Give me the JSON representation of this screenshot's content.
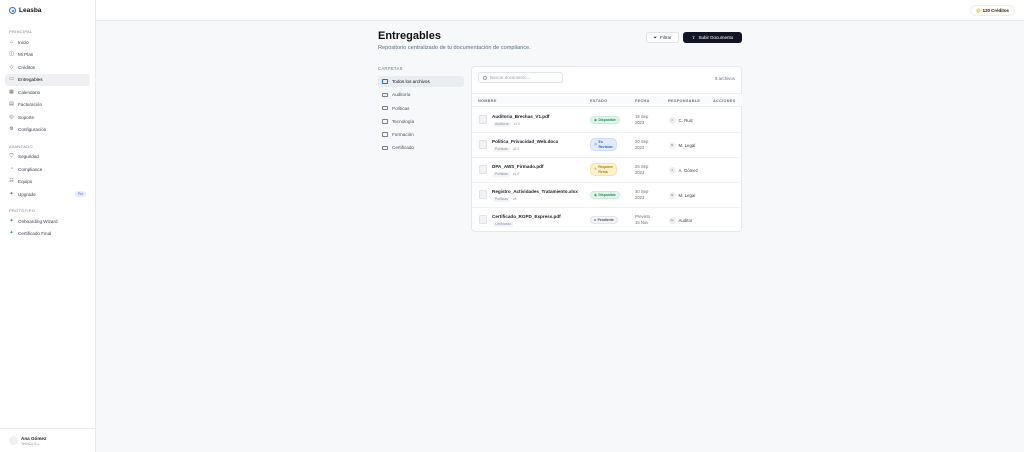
{
  "brand": {
    "name": "Leasba",
    "icon": "logo-icon"
  },
  "topbar": {
    "credits": "120 Créditos",
    "icon": "coin-icon"
  },
  "sidebar": {
    "sections": [
      {
        "label": "PRINCIPAL",
        "items": [
          {
            "label": "Inicio",
            "icon": "home-icon"
          },
          {
            "label": "Mi Plan",
            "icon": "plan-icon"
          },
          {
            "label": "Créditos",
            "icon": "tag-icon"
          },
          {
            "label": "Entregables",
            "icon": "folder-icon",
            "active": true
          },
          {
            "label": "Calendario",
            "icon": "calendar-icon"
          },
          {
            "label": "Facturación",
            "icon": "invoice-icon"
          },
          {
            "label": "Soporte",
            "icon": "support-icon"
          },
          {
            "label": "Configuración",
            "icon": "gear-icon"
          }
        ]
      },
      {
        "label": "AVANZADO",
        "items": [
          {
            "label": "Seguridad",
            "icon": "shield-icon"
          },
          {
            "label": "Compliance",
            "icon": "compliance-icon"
          },
          {
            "label": "Equipo",
            "icon": "team-icon"
          },
          {
            "label": "Upgrade",
            "icon": "upgrade-icon",
            "badge": "Pro"
          }
        ]
      },
      {
        "label": "PROTOTIPO",
        "items": [
          {
            "label": "Onboarding Wizard",
            "icon": "sparkle-icon"
          },
          {
            "label": "Certificado Final",
            "icon": "sparkle-icon"
          }
        ]
      }
    ],
    "user": {
      "name": "Ana Gómez",
      "company": "TechCo S.L."
    }
  },
  "page": {
    "title": "Entregables",
    "subtitle": "Repositorio centralizado de tu documentación de compliance.",
    "filter_label": "Filtrar",
    "upload_label": "Subir Documento"
  },
  "folders": {
    "label": "CARPETAS",
    "items": [
      "Todos los archivos",
      "Auditoría",
      "Políticas",
      "Tecnología",
      "Formación",
      "Certificado"
    ]
  },
  "table": {
    "search_placeholder": "Buscar documento...",
    "file_count": "5 archivos",
    "columns": [
      "NOMBRE",
      "ESTADO",
      "FECHA",
      "RESPONSABLE",
      "ACCIONES"
    ],
    "rows": [
      {
        "name": "Auditoria_Brechas_V1.pdf",
        "category": "Auditoría",
        "meta": "v1.0",
        "status": "Disponible",
        "status_type": "ok",
        "date_line1": "15 Sep",
        "date_line2": "2023",
        "owner_initials": "C",
        "owner": "C. Ruiz"
      },
      {
        "name": "Politica_Privacidad_Web.docx",
        "category": "Políticas",
        "meta": "v2.0",
        "status_line1": "En",
        "status_line2": "Revisión",
        "status_type": "review",
        "date_line1": "20 Sep",
        "date_line2": "2023",
        "owner_initials": "M",
        "owner": "M. Legal"
      },
      {
        "name": "DPA_AWS_Firmado.pdf",
        "category": "Políticas",
        "meta": "v1.0",
        "status_line1": "Requiere",
        "status_line2": "Firma",
        "status_type": "sign",
        "date_line1": "25 Sep",
        "date_line2": "2023",
        "owner_initials": "A",
        "owner": "A. Gómez"
      },
      {
        "name": "Registro_Actividades_Tratamiento.xlsx",
        "category": "Políticas",
        "meta": "v3",
        "status": "Disponible",
        "status_type": "ok",
        "date_line1": "30 Sep",
        "date_line2": "2023",
        "owner_initials": "M",
        "owner": "M. Legal"
      },
      {
        "name": "Certificado_RGPD_Express.pdf",
        "category": "Certificado",
        "meta": "",
        "status": "Pendiente",
        "status_type": "pending",
        "date_line1": "Previsto",
        "date_line2": "15 Nov",
        "owner_initials": "Au",
        "owner": "Auditor"
      }
    ]
  },
  "colors": {
    "accent": "#2a6cf0",
    "primary_button": "#0f1524",
    "ok": "#1e8a58",
    "review": "#2a5fcf",
    "sign": "#a87600"
  }
}
